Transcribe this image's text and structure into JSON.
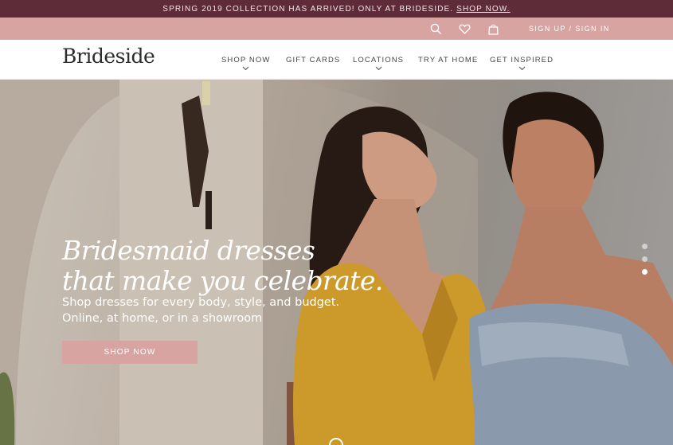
{
  "announcement": {
    "text": "SPRING 2019 COLLECTION HAS ARRIVED! ONLY AT BRIDESIDE.",
    "link": "SHOP NOW."
  },
  "utility": {
    "signin": "SIGN UP / SIGN IN",
    "icons": [
      "search-icon",
      "heart-icon",
      "bag-icon"
    ]
  },
  "nav": {
    "logo": "Brideside",
    "items": [
      {
        "label": "SHOP NOW",
        "has_dropdown": true
      },
      {
        "label": "GIFT CARDS",
        "has_dropdown": false
      },
      {
        "label": "LOCATIONS",
        "has_dropdown": true
      },
      {
        "label": "TRY AT HOME",
        "has_dropdown": false
      },
      {
        "label": "GET INSPIRED",
        "has_dropdown": true
      }
    ]
  },
  "hero": {
    "title_line1": "Bridesmaid dresses",
    "title_line2": "that make you celebrate.",
    "subtitle_line1": "Shop dresses for every body, style, and budget.",
    "subtitle_line2": "Online, at home, or in a showroom",
    "cta": "SHOP NOW",
    "slides": 3,
    "active_slide": 3
  },
  "colors": {
    "announce_bg": "#5e2c39",
    "utility_bg": "#d8a4a2",
    "cta_bg": "#d8a4a2",
    "text_dark": "#2c2c2c"
  }
}
